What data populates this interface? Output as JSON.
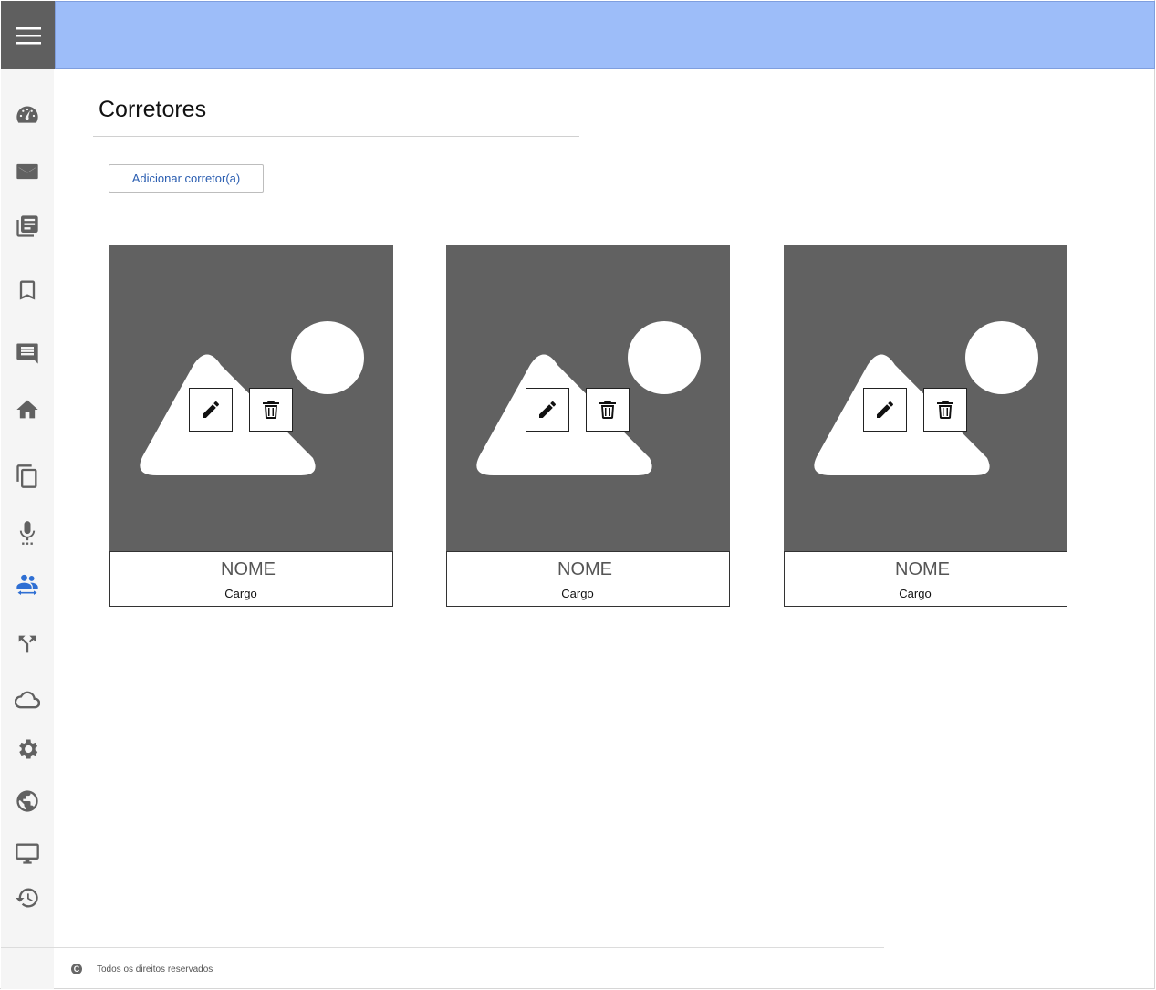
{
  "page": {
    "title": "Corretores",
    "add_button": "Adicionar corretor(a)"
  },
  "sidebar": {
    "items": [
      {
        "icon": "dashboard-icon"
      },
      {
        "icon": "mail-icon"
      },
      {
        "icon": "library-icon"
      },
      {
        "icon": "bookmark-icon"
      },
      {
        "icon": "comment-icon"
      },
      {
        "icon": "home-icon"
      },
      {
        "icon": "copy-icon"
      },
      {
        "icon": "microphone-icon"
      },
      {
        "icon": "people-icon",
        "active": true
      },
      {
        "icon": "split-arrows-icon"
      },
      {
        "icon": "cloud-icon"
      },
      {
        "icon": "gear-icon"
      },
      {
        "icon": "globe-icon"
      },
      {
        "icon": "monitor-icon"
      },
      {
        "icon": "history-icon"
      }
    ]
  },
  "cards": [
    {
      "name": "NOME",
      "role": "Cargo"
    },
    {
      "name": "NOME",
      "role": "Cargo"
    },
    {
      "name": "NOME",
      "role": "Cargo"
    }
  ],
  "footer": {
    "copyright_symbol": "C",
    "text": "Todos os direitos reservados"
  },
  "colors": {
    "topbar": "#9dbdf9",
    "active_icon": "#2f6fd3",
    "image_placeholder": "#616161"
  }
}
